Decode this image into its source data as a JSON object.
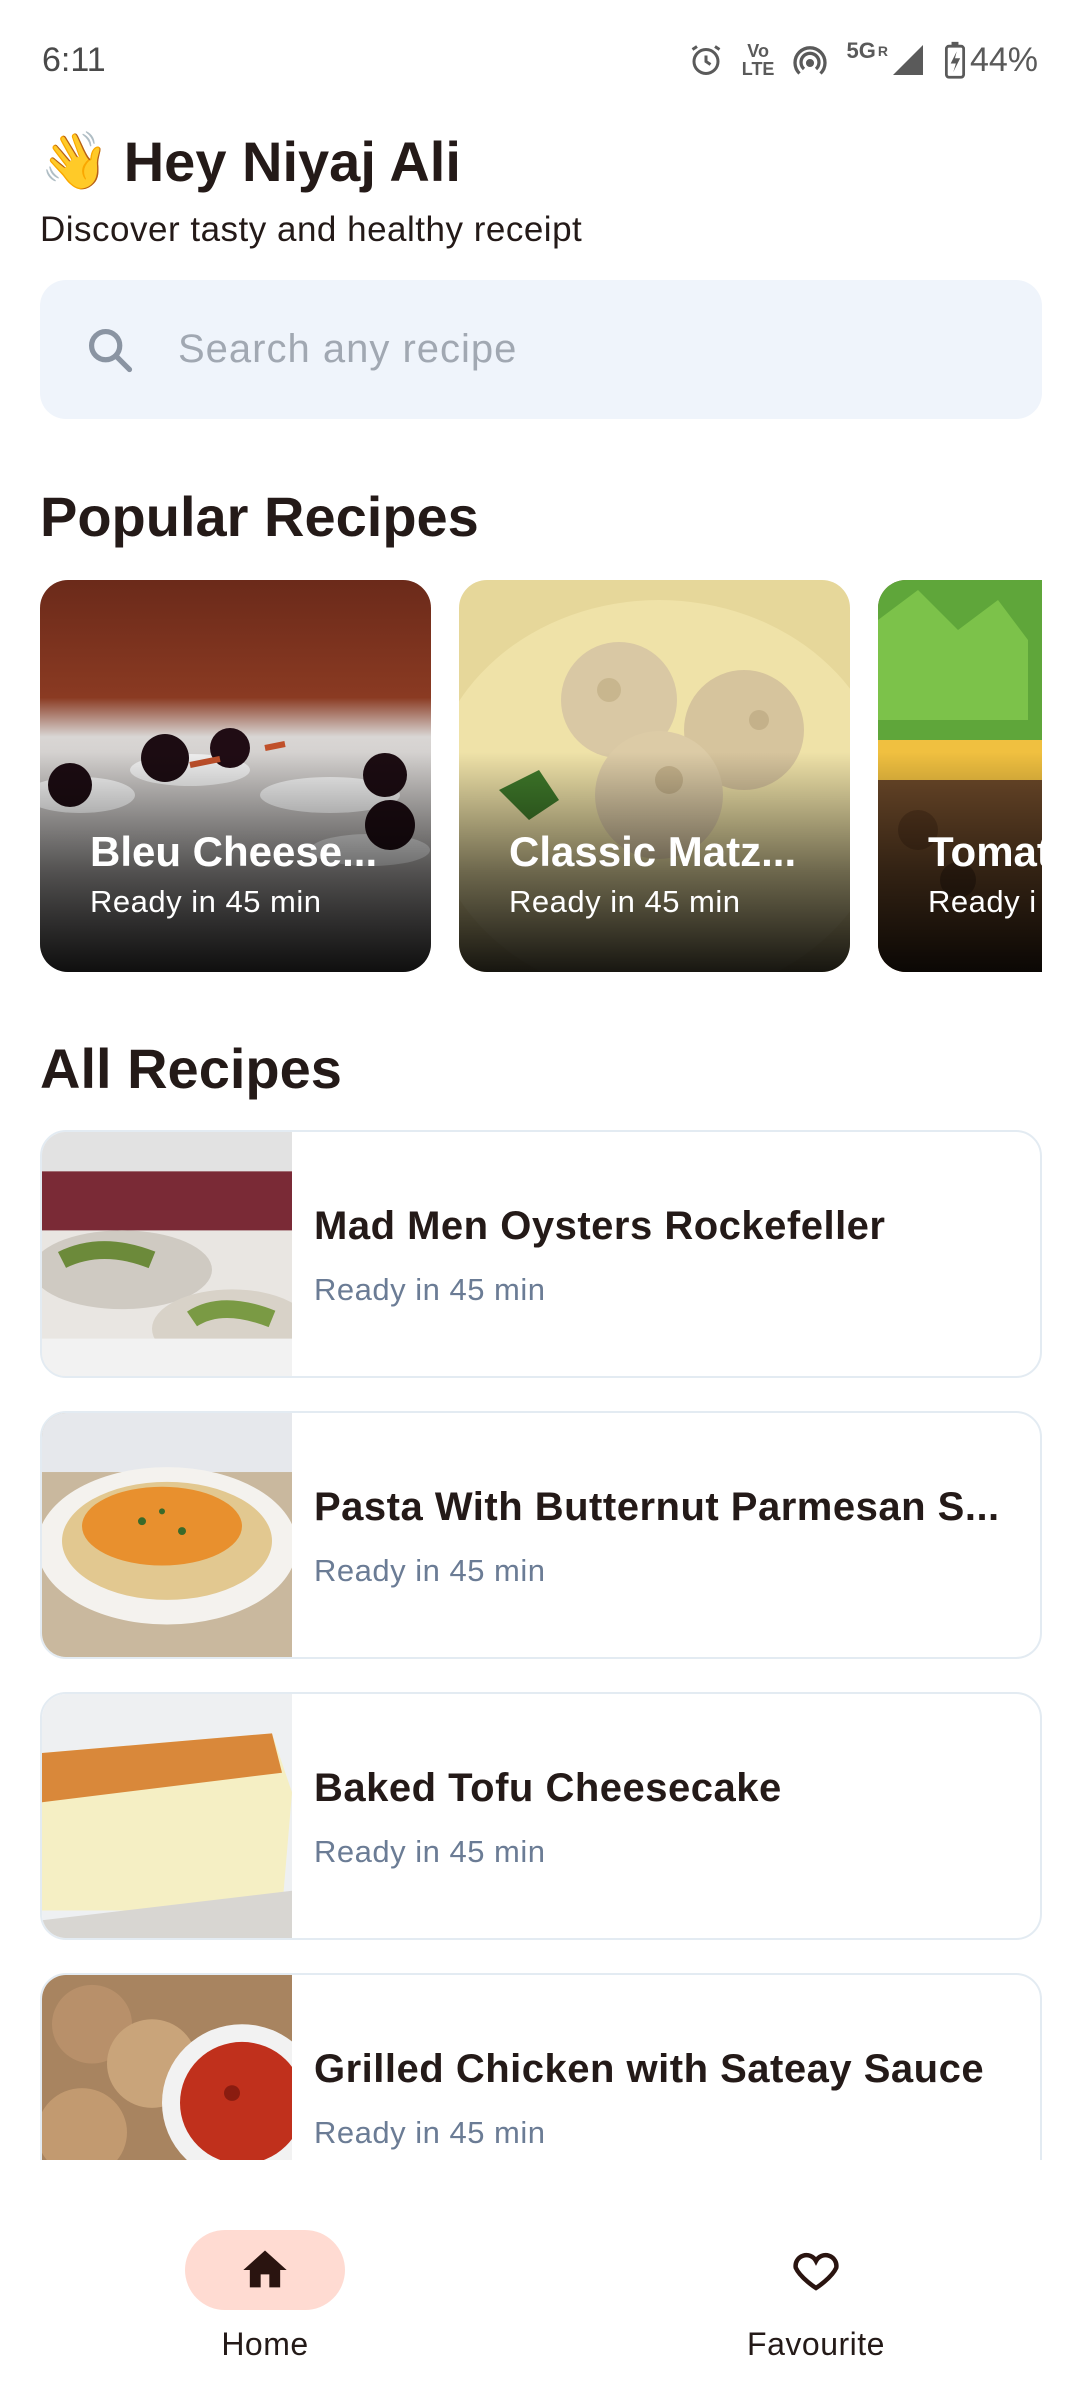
{
  "status_bar": {
    "time": "6:11",
    "network_label": "5G",
    "roaming_label": "R",
    "volte_top": "Vo",
    "volte_bottom": "LTE",
    "battery": "44%"
  },
  "greeting": {
    "emoji": "👋",
    "title": "Hey Niyaj Ali",
    "subtitle": "Discover tasty and healthy receipt"
  },
  "search": {
    "placeholder": "Search any recipe",
    "value": ""
  },
  "popular": {
    "title": "Popular Recipes",
    "cards": [
      {
        "title": "Bleu Cheese...",
        "time": "Ready in 45 min"
      },
      {
        "title": "Classic Matz...",
        "time": "Ready in 45 min"
      },
      {
        "title": "Tomat",
        "time": "Ready i"
      }
    ]
  },
  "all_recipes": {
    "title": "All Recipes",
    "items": [
      {
        "title": "Mad Men Oysters Rockefeller",
        "time": "Ready in 45 min"
      },
      {
        "title": "Pasta With Butternut Parmesan S...",
        "time": "Ready in 45 min"
      },
      {
        "title": "Baked Tofu Cheesecake",
        "time": "Ready in 45 min"
      },
      {
        "title": "Grilled Chicken with Sateay Sauce",
        "time": "Ready in 45 min"
      }
    ]
  },
  "bottom_nav": {
    "items": [
      {
        "label": "Home",
        "icon": "home-icon",
        "active": true
      },
      {
        "label": "Favourite",
        "icon": "heart-icon",
        "active": false
      }
    ]
  },
  "colors": {
    "accent_pill": "#ffdbd2",
    "search_bg": "#eff4fb",
    "text_primary": "#241a18",
    "text_secondary": "#6b7c95",
    "card_border": "#e3ebf2"
  }
}
